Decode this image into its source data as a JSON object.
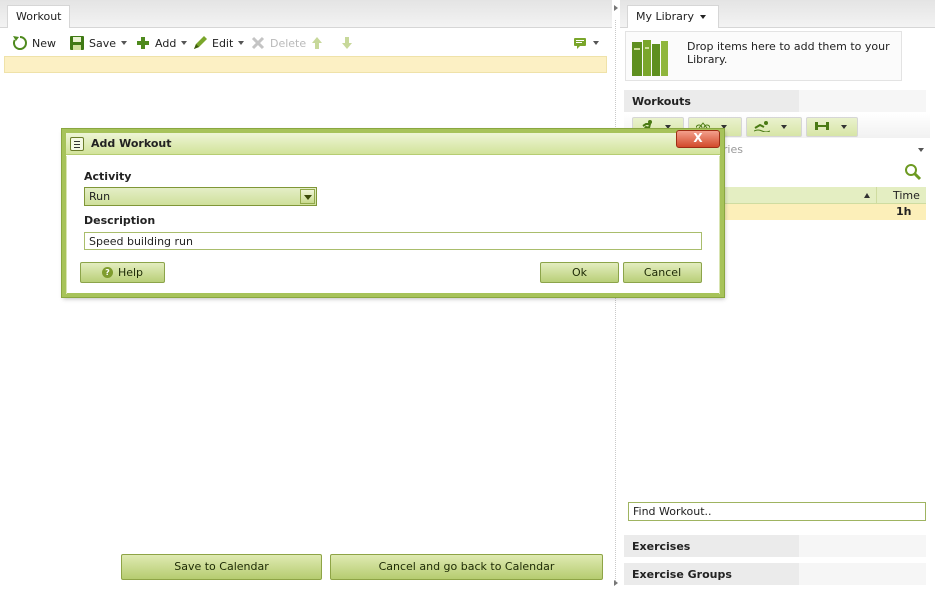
{
  "left": {
    "tab_label": "Workout",
    "toolbar": {
      "new_label": "New",
      "save_label": "Save",
      "add_label": "Add",
      "edit_label": "Edit",
      "delete_label": "Delete"
    },
    "save_to_calendar_label": "Save to Calendar",
    "cancel_back_label": "Cancel and go back to Calendar"
  },
  "right": {
    "tab_label": "My Library",
    "drop_text": "Drop items here to add them to your Library.",
    "workouts_header": "Workouts",
    "filter_text": "Bike: All Categories",
    "grid": {
      "time_header": "Time",
      "rows": [
        {
          "name_fragment": "e",
          "time": "1h"
        }
      ]
    },
    "find_value": "Find Workout..",
    "exercises_header": "Exercises",
    "exercise_groups_header": "Exercise Groups"
  },
  "dialog": {
    "title": "Add Workout",
    "close_glyph": "X",
    "activity_label": "Activity",
    "activity_value": "Run",
    "description_label": "Description",
    "description_value": "Speed building run",
    "help_label": "Help",
    "ok_label": "Ok",
    "cancel_label": "Cancel"
  },
  "colors": {
    "accent_green": "#a7c35a",
    "status_yellow": "#fcf0c4",
    "close_red": "#d24a2b"
  },
  "icons": [
    "new-icon",
    "save-icon",
    "add-icon",
    "edit-icon",
    "delete-icon",
    "move-up-icon",
    "move-down-icon",
    "comment-icon",
    "library-books-icon",
    "search-icon",
    "run-icon",
    "bike-icon",
    "swim-icon",
    "strength-icon",
    "help-icon",
    "dialog-menu-icon"
  ]
}
